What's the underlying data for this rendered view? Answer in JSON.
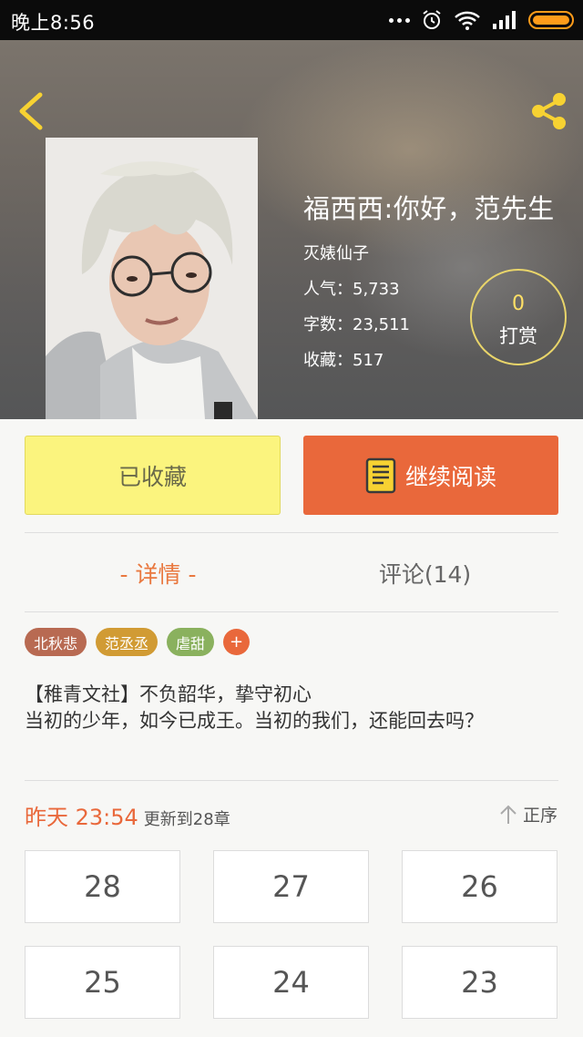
{
  "status_bar": {
    "time": "晚上8:56"
  },
  "book": {
    "title": "福西西:你好，范先生",
    "author": "灭婊仙子",
    "popularity": "人气：5,733",
    "word_count": "字数：23,511",
    "favorites": "收藏：517"
  },
  "tip": {
    "count": "0",
    "label": "打赏"
  },
  "actions": {
    "favorite_label": "已收藏",
    "read_label": "继续阅读"
  },
  "tabs": [
    {
      "label": "- 详情 -",
      "active": true
    },
    {
      "label": "评论(14)",
      "active": false
    }
  ],
  "tags": [
    {
      "label": "北秋悲",
      "color": "#b86a52"
    },
    {
      "label": "范丞丞",
      "color": "#d19b34"
    },
    {
      "label": "虐甜",
      "color": "#8ab15e"
    }
  ],
  "tag_add_label": "+",
  "description": {
    "line1": "【稚青文社】不负韶华，挚守初心",
    "line2": "当初的少年，如今已成王。当初的我们，还能回去吗？"
  },
  "update": {
    "time": "昨天 23:54",
    "text": "更新到28章",
    "order_label": "正序"
  },
  "chapters": [
    "28",
    "27",
    "26",
    "25",
    "24",
    "23"
  ],
  "colors": {
    "accent": "#e9683b",
    "favorite_bg": "#fbf47e",
    "tip_border": "#e9d56a"
  }
}
